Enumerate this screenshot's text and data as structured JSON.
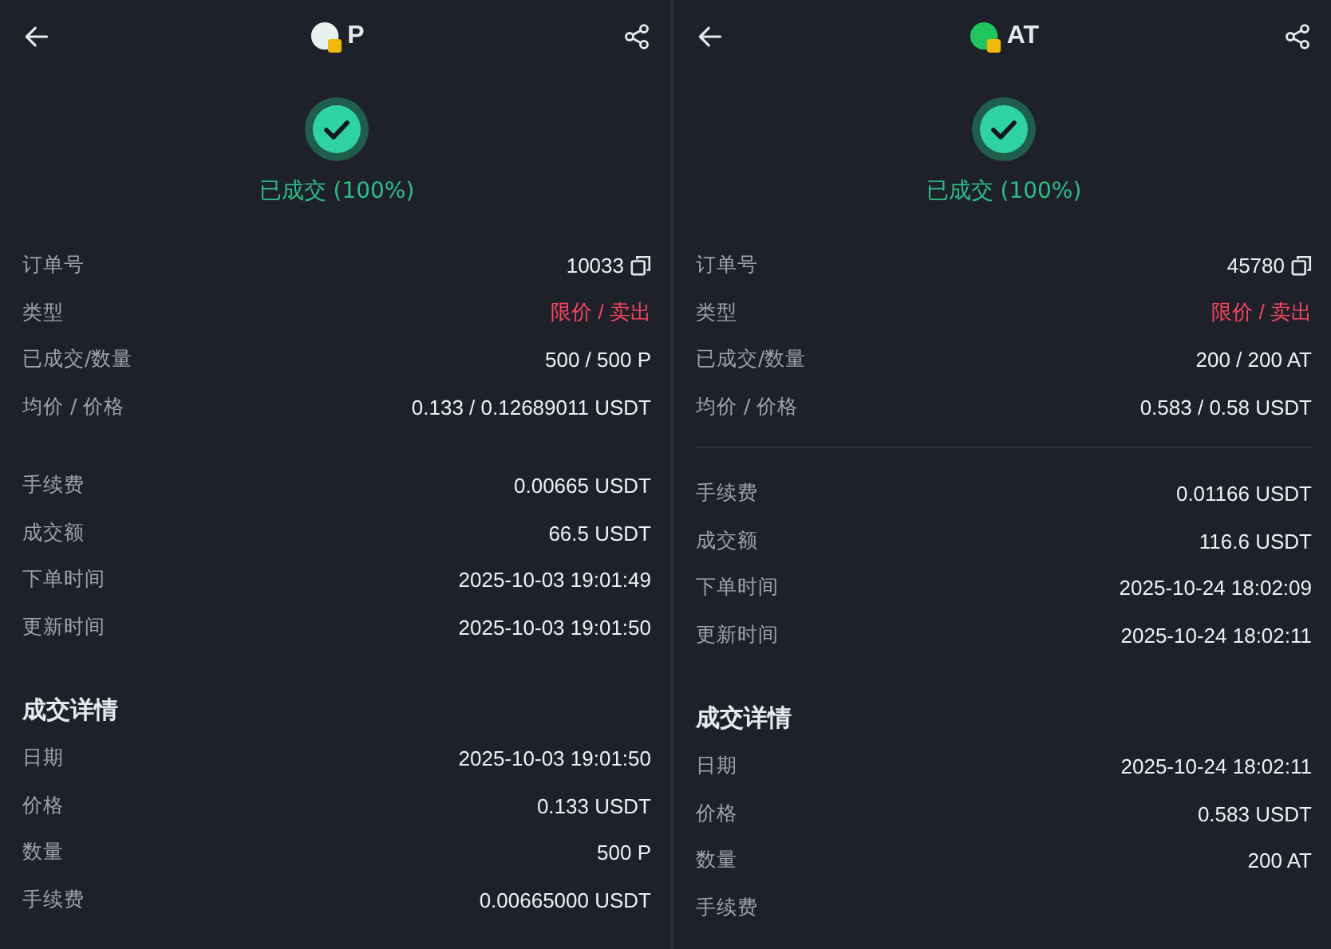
{
  "panels": [
    {
      "coin": "P",
      "status": "已成交 (100%)",
      "divider": false,
      "sections": [
        {
          "rows": [
            {
              "label": "订单号",
              "value": "10033",
              "kind": "copy"
            },
            {
              "label": "类型",
              "value": "限价 / 卖出",
              "kind": "sell"
            },
            {
              "label": "已成交/数量",
              "value": "500 / 500 P",
              "kind": "plain"
            },
            {
              "label": "均价 / 价格",
              "value": "0.133 / 0.12689011 USDT",
              "kind": "plain"
            }
          ]
        },
        {
          "rows": [
            {
              "label": "手续费",
              "value": "0.00665 USDT",
              "kind": "plain"
            },
            {
              "label": "成交额",
              "value": "66.5 USDT",
              "kind": "plain"
            },
            {
              "label": "下单时间",
              "value": "2025-10-03 19:01:49",
              "kind": "plain"
            },
            {
              "label": "更新时间",
              "value": "2025-10-03 19:01:50",
              "kind": "plain"
            }
          ]
        },
        {
          "title": "成交详情",
          "rows": [
            {
              "label": "日期",
              "value": "2025-10-03 19:01:50",
              "kind": "plain"
            },
            {
              "label": "价格",
              "value": "0.133 USDT",
              "kind": "plain"
            },
            {
              "label": "数量",
              "value": "500 P",
              "kind": "plain"
            },
            {
              "label": "手续费",
              "value": "0.00665000 USDT",
              "kind": "plain"
            }
          ]
        }
      ]
    },
    {
      "coin": "AT",
      "status": "已成交 (100%)",
      "divider": true,
      "sections": [
        {
          "rows": [
            {
              "label": "订单号",
              "value": "45780",
              "kind": "copy"
            },
            {
              "label": "类型",
              "value": "限价 / 卖出",
              "kind": "sell"
            },
            {
              "label": "已成交/数量",
              "value": "200 / 200 AT",
              "kind": "plain"
            },
            {
              "label": "均价 / 价格",
              "value": "0.583 / 0.58 USDT",
              "kind": "plain"
            }
          ]
        },
        {
          "rows": [
            {
              "label": "手续费",
              "value": "0.01166 USDT",
              "kind": "plain"
            },
            {
              "label": "成交额",
              "value": "116.6 USDT",
              "kind": "plain"
            },
            {
              "label": "下单时间",
              "value": "2025-10-24 18:02:09",
              "kind": "plain"
            },
            {
              "label": "更新时间",
              "value": "2025-10-24 18:02:11",
              "kind": "plain"
            }
          ]
        },
        {
          "title": "成交详情",
          "rows": [
            {
              "label": "日期",
              "value": "2025-10-24 18:02:11",
              "kind": "plain"
            },
            {
              "label": "价格",
              "value": "0.583 USDT",
              "kind": "plain"
            },
            {
              "label": "数量",
              "value": "200 AT",
              "kind": "plain"
            },
            {
              "label": "手续费",
              "kind": "plain"
            }
          ]
        }
      ]
    }
  ]
}
